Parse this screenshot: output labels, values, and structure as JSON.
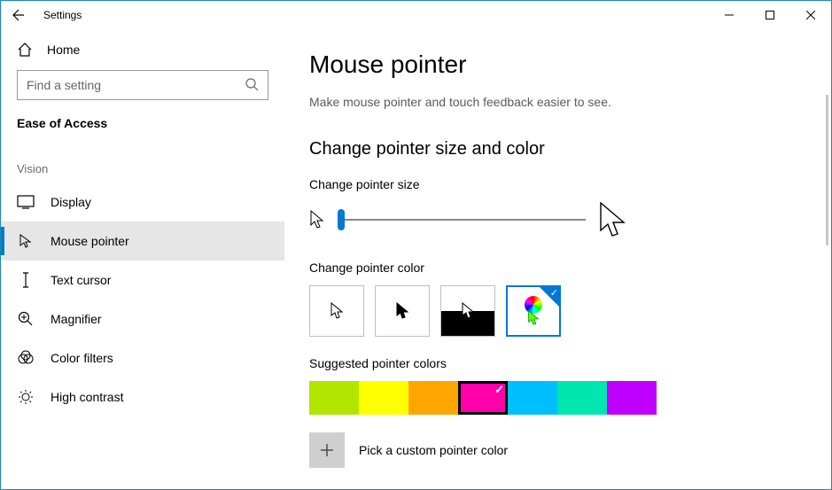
{
  "window": {
    "title": "Settings"
  },
  "sidebar": {
    "home": "Home",
    "search_placeholder": "Find a setting",
    "category": "Ease of Access",
    "group": "Vision",
    "items": [
      {
        "label": "Display"
      },
      {
        "label": "Mouse pointer"
      },
      {
        "label": "Text cursor"
      },
      {
        "label": "Magnifier"
      },
      {
        "label": "Color filters"
      },
      {
        "label": "High contrast"
      }
    ]
  },
  "main": {
    "heading": "Mouse pointer",
    "subtitle": "Make mouse pointer and touch feedback easier to see.",
    "section_heading": "Change pointer size and color",
    "size_label": "Change pointer size",
    "color_label": "Change pointer color",
    "suggested_label": "Suggested pointer colors",
    "suggested_colors": [
      "#b2e600",
      "#ffff00",
      "#ffa500",
      "#ff00aa",
      "#00bfff",
      "#00e6b0",
      "#c000ff"
    ],
    "suggested_selected_index": 3,
    "custom_label": "Pick a custom pointer color"
  }
}
